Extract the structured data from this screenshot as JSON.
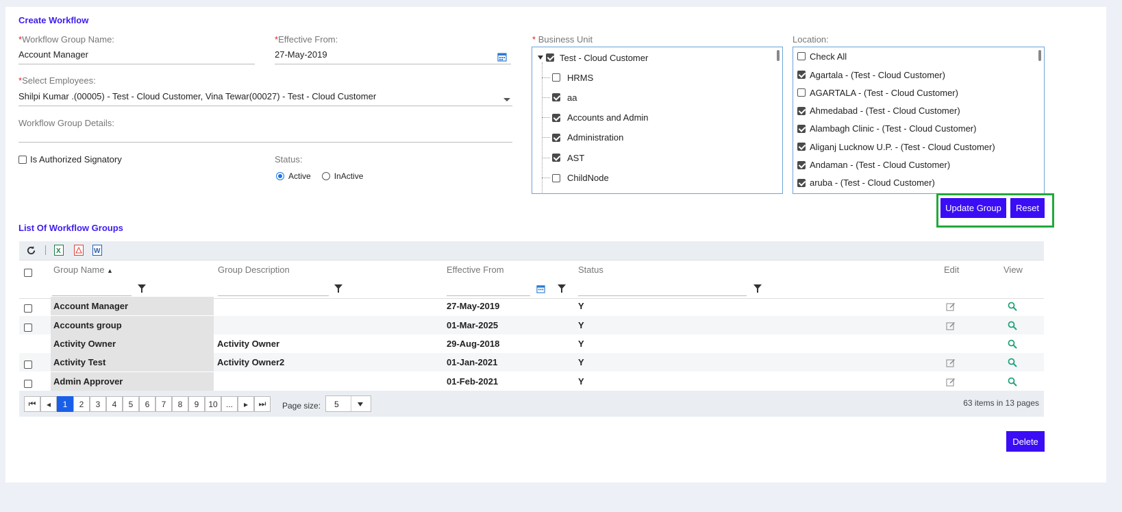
{
  "form": {
    "title": "Create Workflow",
    "group_name_label": "Workflow Group Name:",
    "group_name_value": "Account Manager",
    "effective_from_label": "Effective From:",
    "effective_from_value": "27-May-2019",
    "select_employees_label": "Select Employees:",
    "select_employees_value": "Shilpi Kumar .(00005) - Test - Cloud Customer, Vina Tewar(00027) - Test - Cloud Customer",
    "group_details_label": "Workflow Group Details:",
    "authorized_signatory_label": "Is Authorized Signatory",
    "status_label": "Status:",
    "status_active": "Active",
    "status_inactive": "InActive",
    "business_unit_label": "Business Unit",
    "location_label": "Location:"
  },
  "business_unit": {
    "root": "Test - Cloud Customer",
    "children": [
      "HRMS",
      "aa",
      "Accounts and Admin",
      "Administration",
      "AST",
      "ChildNode"
    ],
    "children_checked": [
      false,
      true,
      true,
      true,
      true,
      false
    ]
  },
  "location": {
    "check_all": "Check All",
    "items": [
      "Agartala - (Test - Cloud Customer)",
      "AGARTALA - (Test - Cloud Customer)",
      "Ahmedabad - (Test - Cloud Customer)",
      "Alambagh Clinic - (Test - Cloud Customer)",
      "Aliganj Lucknow U.P. - (Test - Cloud Customer)",
      "Andaman - (Test - Cloud Customer)",
      "aruba - (Test - Cloud Customer)"
    ],
    "checked": [
      true,
      false,
      true,
      true,
      true,
      true,
      true
    ]
  },
  "actions": {
    "update_group": "Update Group",
    "reset": "Reset",
    "delete": "Delete"
  },
  "list": {
    "title": "List Of Workflow Groups",
    "columns": {
      "group_name": "Group Name",
      "group_description": "Group Description",
      "effective_from": "Effective From",
      "status": "Status",
      "edit": "Edit",
      "view": "View"
    },
    "rows": [
      {
        "name": "Account Manager",
        "description": "",
        "effective_from": "27-May-2019",
        "status": "Y"
      },
      {
        "name": "Accounts group",
        "description": "",
        "effective_from": "01-Mar-2025",
        "status": "Y"
      },
      {
        "name": "Activity Owner",
        "description": "Activity Owner",
        "effective_from": "29-Aug-2018",
        "status": "Y"
      },
      {
        "name": "Activity Test",
        "description": "Activity Owner2",
        "effective_from": "01-Jan-2021",
        "status": "Y"
      },
      {
        "name": "Admin Approver",
        "description": "",
        "effective_from": "01-Feb-2021",
        "status": "Y"
      }
    ]
  },
  "pager": {
    "pages": [
      "1",
      "2",
      "3",
      "4",
      "5",
      "6",
      "7",
      "8",
      "9",
      "10",
      "..."
    ],
    "page_size_label": "Page size:",
    "page_size_value": "5",
    "summary": "63 items in 13 pages"
  },
  "colors": {
    "accent": "#3b0df5",
    "highlight_border": "#22a83a",
    "link_green": "#1fa37b"
  }
}
